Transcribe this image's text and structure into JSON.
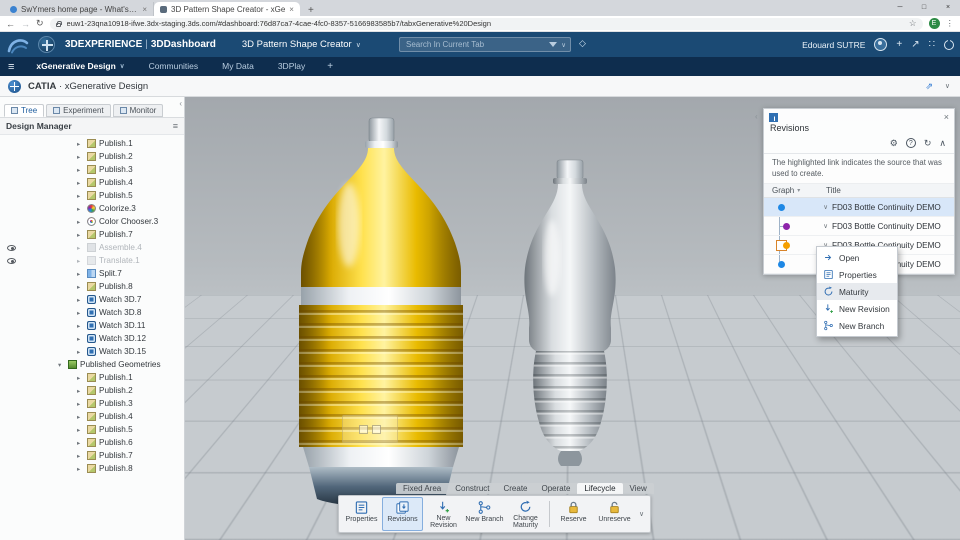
{
  "colors": {
    "accent": "#2e6fb2",
    "selection_row": "#d8e7f9",
    "bottle_yellow": "#f2c200"
  },
  "icons": {
    "back": "←",
    "forward": "→",
    "reload": "↻",
    "star": "☆",
    "menu_dots": "⋮",
    "minimize": "─",
    "maximize": "□",
    "close": "×",
    "new_tab": "+",
    "caret_down": "∨",
    "caret_up": "∧",
    "chevron_left": "‹",
    "gear": "⚙",
    "help": "?",
    "refresh": "↻",
    "hamburger": "≡",
    "share": "↗",
    "add": "+",
    "apps": "∷",
    "tag": "◇",
    "expand": "⇗",
    "node_collapsed": "▸",
    "node_expanded": "▾",
    "sort": "▾"
  },
  "browser": {
    "tab1": "SwYmers home page - What's up",
    "tab2": "3D Pattern Shape Creator - xGe",
    "url": "euw1-23qna10918-ifwe.3dx-staging.3ds.com/#dashboard:76d87ca7-4cae-4fc0-8357-5166983585b7/tabxGenerative%20Design",
    "profile_initial": "E"
  },
  "topbar": {
    "brand": "3DEXPERIENCE",
    "pipe": "|",
    "dashboard": "3DDashboard",
    "app_title": "3D Pattern Shape Creator",
    "search_placeholder": "Search In Current Tab",
    "user_name": "Edouard SUTRE"
  },
  "navbar": {
    "tabs": [
      {
        "label": "xGenerative Design",
        "active": true,
        "caret": true
      },
      {
        "label": "Communities"
      },
      {
        "label": "My Data"
      },
      {
        "label": "3DPlay"
      }
    ],
    "add_label": "+"
  },
  "appbar": {
    "product": "CATIA",
    "sep": "·",
    "app": "xGenerative Design"
  },
  "left_panel": {
    "tabs": [
      {
        "label": "Tree",
        "active": true
      },
      {
        "label": "Experiment"
      },
      {
        "label": "Monitor"
      }
    ],
    "header": "Design Manager",
    "items": [
      {
        "label": "Publish.1",
        "icon": "publish",
        "depth": 3
      },
      {
        "label": "Publish.2",
        "icon": "publish",
        "depth": 3
      },
      {
        "label": "Publish.3",
        "icon": "publish",
        "depth": 3
      },
      {
        "label": "Publish.4",
        "icon": "publish",
        "depth": 3
      },
      {
        "label": "Publish.5",
        "icon": "publish",
        "depth": 3
      },
      {
        "label": "Colorize.3",
        "icon": "colorize",
        "depth": 3
      },
      {
        "label": "Color Chooser.3",
        "icon": "colorchooser",
        "depth": 3
      },
      {
        "label": "Publish.7",
        "icon": "publish",
        "depth": 3
      },
      {
        "label": "Assemble.4",
        "icon": "assemble",
        "depth": 3,
        "gray": true,
        "eye": true
      },
      {
        "label": "Translate.1",
        "icon": "translate",
        "depth": 3,
        "gray": true,
        "eye": true
      },
      {
        "label": "Split.7",
        "icon": "split",
        "depth": 3
      },
      {
        "label": "Publish.8",
        "icon": "publish",
        "depth": 3
      },
      {
        "label": "Watch 3D.7",
        "icon": "watch",
        "depth": 3
      },
      {
        "label": "Watch 3D.8",
        "icon": "watch",
        "depth": 3
      },
      {
        "label": "Watch 3D.11",
        "icon": "watch",
        "depth": 3
      },
      {
        "label": "Watch 3D.12",
        "icon": "watch",
        "depth": 3
      },
      {
        "label": "Watch 3D.15",
        "icon": "watch",
        "depth": 3
      },
      {
        "label": "Published Geometries",
        "icon": "geomset",
        "depth": 2,
        "expanded": true
      },
      {
        "label": "Publish.1",
        "icon": "publish",
        "depth": 3
      },
      {
        "label": "Publish.2",
        "icon": "publish",
        "depth": 3
      },
      {
        "label": "Publish.3",
        "icon": "publish",
        "depth": 3
      },
      {
        "label": "Publish.4",
        "icon": "publish",
        "depth": 3
      },
      {
        "label": "Publish.5",
        "icon": "publish",
        "depth": 3
      },
      {
        "label": "Publish.6",
        "icon": "publish",
        "depth": 3
      },
      {
        "label": "Publish.7",
        "icon": "publish",
        "depth": 3
      },
      {
        "label": "Publish.8",
        "icon": "publish",
        "depth": 3
      }
    ]
  },
  "revisions_panel": {
    "title": "Revisions",
    "info": "The highlighted link indicates the source that was used to create.",
    "col_graph": "Graph",
    "col_title": "Title",
    "rows": [
      {
        "title": "FD03 Bottle Continuity DEMO",
        "dot": "#1e88e5",
        "offset": 0,
        "highlight": true
      },
      {
        "title": "FD03 Bottle Continuity DEMO",
        "dot": "#8e24aa",
        "offset": 9
      },
      {
        "title": "FD03 Bottle Continuity DEMO",
        "dot": "#f59f00",
        "offset": 9,
        "selected": true
      },
      {
        "title": "FD03 Bottle Continuity DEMO",
        "dot": "#1e88e5",
        "offset": 0
      }
    ]
  },
  "context_menu": {
    "items": [
      {
        "label": "Open",
        "icon": "open"
      },
      {
        "label": "Properties",
        "icon": "properties"
      },
      {
        "label": "Maturity",
        "icon": "maturity",
        "highlight": true
      },
      {
        "label": "New Revision",
        "icon": "new-revision"
      },
      {
        "label": "New Branch",
        "icon": "new-branch"
      }
    ]
  },
  "ribbon": {
    "tabs": [
      {
        "label": "Fixed Area"
      },
      {
        "label": "Construct"
      },
      {
        "label": "Create"
      },
      {
        "label": "Operate"
      },
      {
        "label": "Lifecycle",
        "active": true
      },
      {
        "label": "View"
      }
    ],
    "buttons": [
      {
        "label": "Properties",
        "icon": "properties"
      },
      {
        "label": "Revisions",
        "icon": "revisions",
        "active": true
      },
      {
        "label": "New Revision",
        "icon": "new-revision"
      },
      {
        "label": "New Branch",
        "icon": "new-branch"
      },
      {
        "label": "Change Maturity",
        "icon": "maturity"
      },
      {
        "label": "Reserve",
        "icon": "reserve",
        "sep_before": true
      },
      {
        "label": "Unreserve",
        "icon": "unreserve"
      }
    ]
  }
}
